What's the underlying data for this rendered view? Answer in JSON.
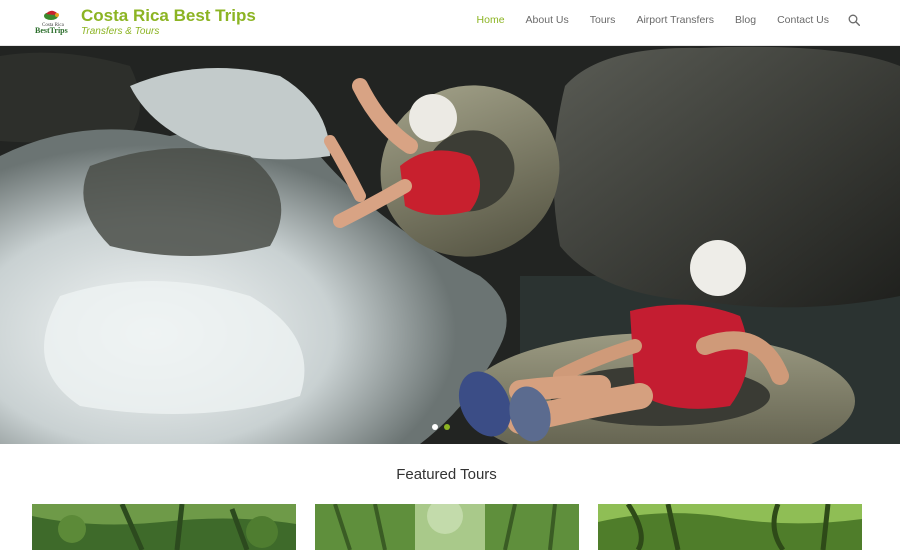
{
  "brand": {
    "title": "Costa Rica Best Trips",
    "subtitle": "Transfers & Tours",
    "logo_text_top": "Costa Rica",
    "logo_text_bottom": "BestTrips"
  },
  "nav": {
    "items": [
      {
        "label": "Home",
        "active": true
      },
      {
        "label": "About Us",
        "active": false
      },
      {
        "label": "Tours",
        "active": false
      },
      {
        "label": "Airport Transfers",
        "active": false
      },
      {
        "label": "Blog",
        "active": false
      },
      {
        "label": "Contact Us",
        "active": false
      }
    ],
    "search_icon": "search-icon"
  },
  "hero": {
    "slide_count": 2,
    "active_slide": 2
  },
  "featured": {
    "title": "Featured Tours",
    "cards": 3
  },
  "colors": {
    "brand_green": "#8cb423",
    "nav_text": "#6a6a6a",
    "heading_text": "#333333"
  }
}
